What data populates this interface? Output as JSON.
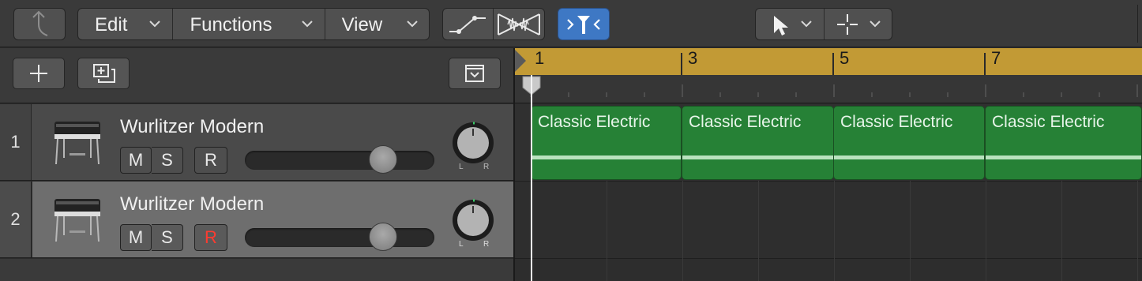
{
  "toolbar": {
    "menus": {
      "edit": "Edit",
      "functions": "Functions",
      "view": "View"
    },
    "chevron": "chevron-down",
    "accent_color": "#3e78c4"
  },
  "tracks": [
    {
      "number": "1",
      "name": "Wurlitzer Modern",
      "mute": "M",
      "solo": "S",
      "record": "R",
      "record_armed": false,
      "volume": 0.73,
      "pan_left": "L",
      "pan_right": "R"
    },
    {
      "number": "2",
      "name": "Wurlitzer Modern",
      "mute": "M",
      "solo": "S",
      "record": "R",
      "record_armed": true,
      "volume": 0.73,
      "pan_left": "L",
      "pan_right": "R"
    }
  ],
  "ruler": {
    "marks": [
      "1",
      "3",
      "5",
      "7"
    ],
    "color": "#c29a35"
  },
  "regions": [
    {
      "name": "Classic Electric"
    },
    {
      "name": "Classic Electric"
    },
    {
      "name": "Classic Electric"
    },
    {
      "name": "Classic Electric"
    }
  ],
  "region_color": "#268136"
}
